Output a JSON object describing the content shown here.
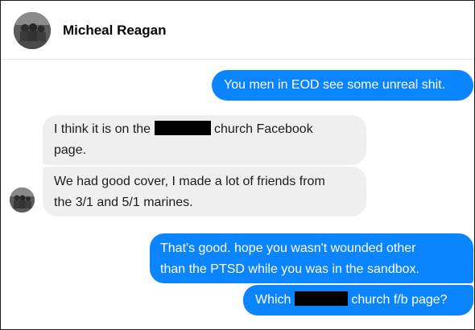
{
  "header": {
    "contact_name": "Micheal Reagan",
    "avatar_icon": "profile-photo-avatar"
  },
  "messages": [
    {
      "direction": "outgoing",
      "text": "You men in EOD see some unreal shit."
    },
    {
      "direction": "incoming",
      "line1_before": "I think it is on the",
      "line1_after": "church Facebook",
      "line2": "page.",
      "redacted": true
    },
    {
      "direction": "incoming",
      "line1": "We had good cover, I made a lot of friends from",
      "line2": "the 3/1 and 5/1 marines."
    },
    {
      "direction": "outgoing",
      "line1": "That's good. hope you wasn't wounded other",
      "line2": "than the PTSD while you was in the sandbox."
    },
    {
      "direction": "outgoing",
      "before": "Which",
      "after": "church f/b page?",
      "redacted": true
    }
  ],
  "colors": {
    "outgoing_bubble": "#0a84ff",
    "incoming_bubble": "#efefef",
    "redaction": "#000000"
  }
}
